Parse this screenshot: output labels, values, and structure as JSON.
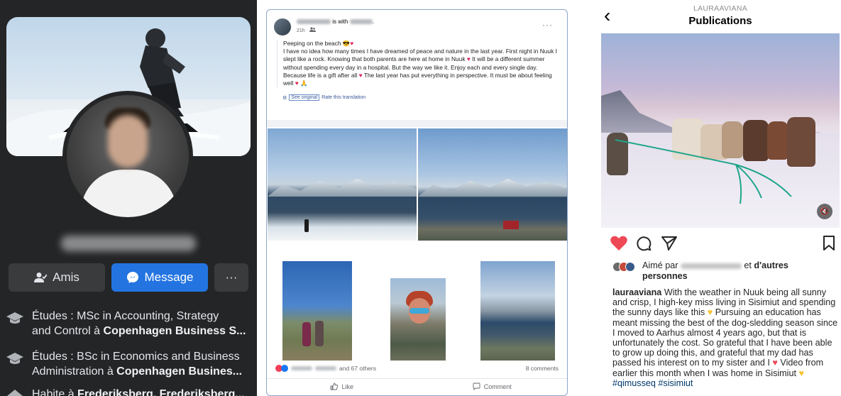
{
  "facebook_profile": {
    "buttons": {
      "friends": "Amis",
      "message": "Message",
      "more": "···"
    },
    "about": [
      {
        "line1_prefix": "Études : MSc in Accounting, Strategy",
        "line2_prefix": "and Control à ",
        "line2_bold": "Copenhagen Business S..."
      },
      {
        "line1_prefix": "Études : BSc in Economics and Business",
        "line2_prefix": "Administration à ",
        "line2_bold": "Copenhagen Busines..."
      },
      {
        "line1_prefix": "Habite à ",
        "line1_bold": "Frederiksberg, Frederiksberg..."
      }
    ]
  },
  "facebook_post": {
    "with_text": "is with",
    "time": "21h ·",
    "more": "···",
    "text": {
      "title": "Peeping on the beach",
      "body": "I have no idea how many times I have dreamed of peace and nature in the last year. First night in Nuuk I slept like a rock. Knowing that both parents are here at home in Nuuk",
      "body2": "It will be a different summer without spending every day in a hospital. But the way we like it. Enjoy each and every single day. Because life is a gift after all",
      "body3": "The last year has put everything in perspective. It must be about feeling well"
    },
    "translation": {
      "see_original": "See original",
      "rate": "Rate this translation"
    },
    "reactions": {
      "others": "and 67 others",
      "comments": "8 comments"
    },
    "actions": {
      "like": "Like",
      "comment": "Comment"
    }
  },
  "instagram_post": {
    "username": "LAURAAVIANA",
    "title": "Publications",
    "liked_by": {
      "prefix": "Aimé par",
      "suffix": "et",
      "bold": "d'autres personnes"
    },
    "caption": {
      "username": "lauraaviana",
      "text1": "With the weather in Nuuk being all sunny and crisp, I high-key miss living in Sisimiut and spending the sunny days like this",
      "text2": "Pursuing an education has meant missing the best of the dog-sledding season since I moved to Aarhus almost 4 years ago, but that is unfortunately the cost. So grateful that I have been able to grow up doing this, and grateful that my dad has passed his interest on to my sister and I",
      "text3": "Video from earlier this month when I was home in Sisimiut",
      "hashtags": "#qimusseq #sisimiut"
    }
  },
  "colors": {
    "fb_dark_bg": "#242526",
    "fb_blue": "#2374e1",
    "fb_button_gray": "#3a3b3c",
    "ig_heart": "#ed4956",
    "ig_hashtag": "#00376b"
  }
}
